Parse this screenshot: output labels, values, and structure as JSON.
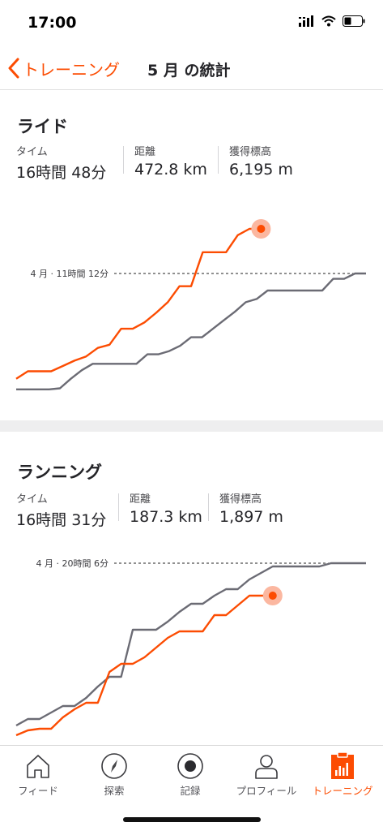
{
  "status_bar": {
    "time": "17:00"
  },
  "nav": {
    "back_label": "トレーニング",
    "title": "5 月 の統計"
  },
  "ride": {
    "title": "ライド",
    "stats": [
      {
        "label": "タイム",
        "value": "16時間 48分"
      },
      {
        "label": "距離",
        "value": "472.8 km"
      },
      {
        "label": "獲得標高",
        "value": "6,195 m"
      }
    ],
    "reference_label": "4 月 · 11時間 12分"
  },
  "run": {
    "title": "ランニング",
    "stats": [
      {
        "label": "タイム",
        "value": "16時間 31分"
      },
      {
        "label": "距離",
        "value": "187.3 km"
      },
      {
        "label": "獲得標高",
        "value": "1,897 m"
      }
    ],
    "reference_label": "4 月 · 20時間 6分"
  },
  "tab_bar": {
    "items": [
      {
        "label": "フィード",
        "icon": "home-icon"
      },
      {
        "label": "探索",
        "icon": "compass-icon"
      },
      {
        "label": "記録",
        "icon": "record-icon"
      },
      {
        "label": "プロフィール",
        "icon": "profile-icon"
      },
      {
        "label": "トレーニング",
        "icon": "training-icon",
        "active": true
      }
    ]
  },
  "colors": {
    "accent": "#fc4c02",
    "previous_month": "#6b6b74",
    "dot_halo": "#fbb7a0"
  },
  "chart_data": [
    {
      "type": "line",
      "title": "ライド",
      "reference": {
        "label": "4 月 · 11時間 12分",
        "style": "dashed"
      },
      "series": [
        {
          "name": "5 月",
          "color": "#fc4c02",
          "values": [
            0.01,
            0.08,
            0.08,
            0.08,
            0.13,
            0.18,
            0.22,
            0.3,
            0.33,
            0.48,
            0.48,
            0.54,
            0.63,
            0.73,
            0.88,
            0.88,
            1.2,
            1.2,
            1.2,
            1.36,
            1.42,
            1.42
          ]
        },
        {
          "name": "4 月",
          "color": "#6b6b74",
          "values": [
            -0.09,
            -0.09,
            -0.09,
            -0.09,
            -0.08,
            0.01,
            0.09,
            0.15,
            0.15,
            0.15,
            0.15,
            0.15,
            0.24,
            0.24,
            0.27,
            0.32,
            0.4,
            0.4,
            0.48,
            0.56,
            0.64,
            0.73,
            0.76,
            0.84,
            0.84,
            0.84,
            0.84,
            0.84,
            0.84,
            0.95,
            0.95,
            1.0,
            1.0
          ]
        }
      ]
    },
    {
      "type": "line",
      "title": "ランニング",
      "reference": {
        "label": "4 月 · 20時間 6分",
        "style": "dashed"
      },
      "series": [
        {
          "name": "5 月",
          "color": "#fc4c02",
          "values": [
            -0.06,
            -0.03,
            -0.02,
            -0.02,
            0.05,
            0.1,
            0.14,
            0.14,
            0.33,
            0.38,
            0.38,
            0.42,
            0.48,
            0.54,
            0.58,
            0.58,
            0.58,
            0.68,
            0.68,
            0.74,
            0.8,
            0.8,
            0.8
          ]
        },
        {
          "name": "4 月",
          "color": "#6b6b74",
          "values": [
            0.0,
            0.04,
            0.04,
            0.08,
            0.12,
            0.12,
            0.17,
            0.24,
            0.3,
            0.3,
            0.59,
            0.59,
            0.59,
            0.64,
            0.7,
            0.75,
            0.75,
            0.8,
            0.84,
            0.84,
            0.9,
            0.94,
            0.98,
            0.98,
            0.98,
            0.98,
            0.98,
            1.0,
            1.0,
            1.0,
            1.0
          ]
        }
      ]
    }
  ]
}
